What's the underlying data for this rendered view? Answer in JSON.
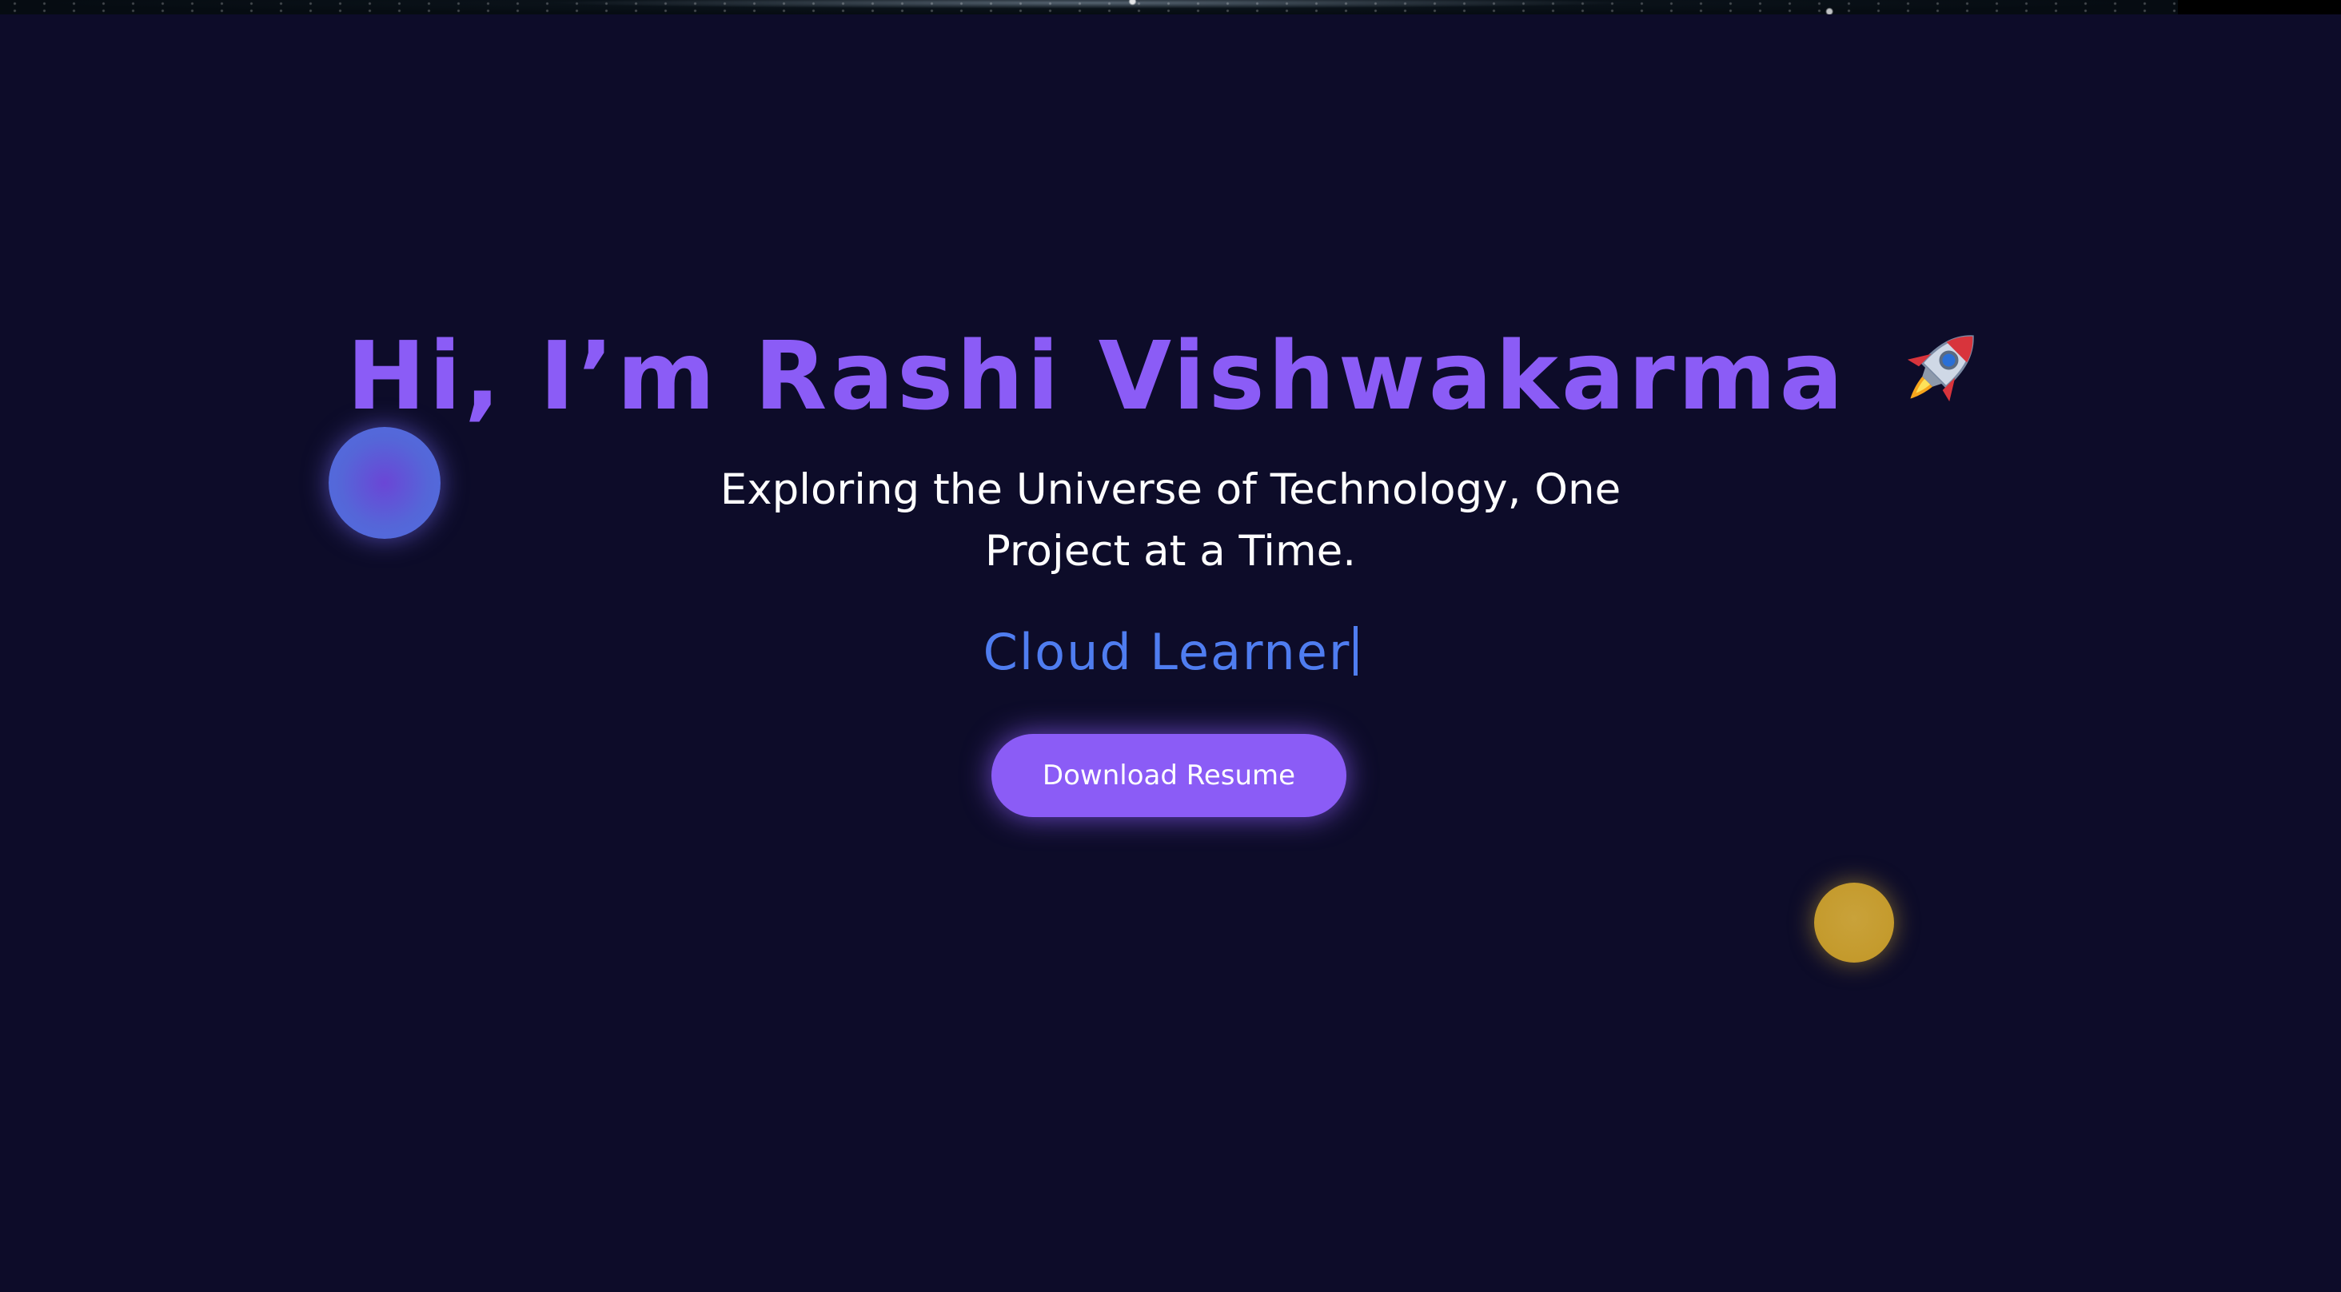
{
  "hero": {
    "title": "Hi, I’m Rashi Vishwakarma",
    "title_icon": "rocket-emoji",
    "subtitle": "Exploring the Universe of Technology, One Project at a Time.",
    "typed_role": "Cloud Learner",
    "resume_button_label": "Download Resume"
  },
  "decorations": {
    "planets": [
      {
        "name": "planet-blue",
        "color": "#5a62dc"
      },
      {
        "name": "planet-gold",
        "color": "#c9a23a"
      }
    ],
    "top_strip": "starfield-image"
  },
  "colors": {
    "background": "#0d0c29",
    "title": "#8b5cf6",
    "subtitle": "#ffffff",
    "typed_text": "#4f7df0",
    "button": "#8b5cf6",
    "button_text": "#ffffff"
  }
}
